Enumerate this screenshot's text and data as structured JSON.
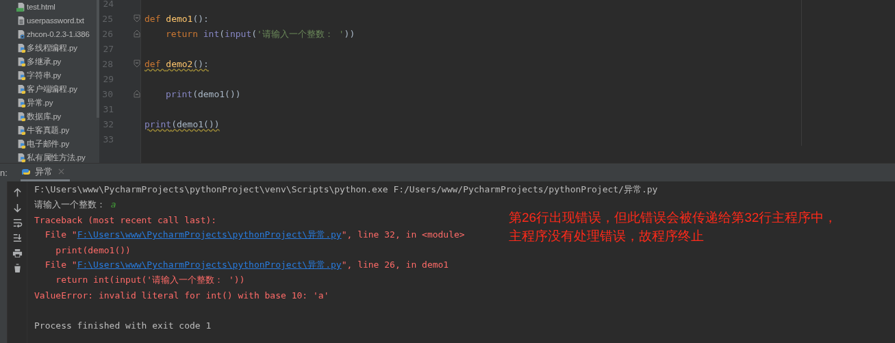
{
  "project_tree": {
    "items": [
      {
        "name": "test.html",
        "kind": "html"
      },
      {
        "name": "userpassword.txt",
        "kind": "text"
      },
      {
        "name": "zhcon-0.2.3-1.i386",
        "kind": "unknown"
      },
      {
        "name": "多线程编程.py",
        "kind": "python"
      },
      {
        "name": "多继承.py",
        "kind": "python"
      },
      {
        "name": "字符串.py",
        "kind": "python"
      },
      {
        "name": "客户端编程.py",
        "kind": "python"
      },
      {
        "name": "异常.py",
        "kind": "python"
      },
      {
        "name": "数据库.py",
        "kind": "python"
      },
      {
        "name": "牛客真题.py",
        "kind": "python"
      },
      {
        "name": "电子邮件.py",
        "kind": "python"
      },
      {
        "name": "私有属性方法.py",
        "kind": "python"
      }
    ]
  },
  "editor": {
    "lines": [
      {
        "number": "24"
      },
      {
        "number": "25",
        "fold_start": true,
        "fold_end": false,
        "indented": false,
        "warning": false,
        "tokens": [
          {
            "kind": "keyword",
            "text": "def "
          },
          {
            "kind": "defname",
            "text": "demo1"
          },
          {
            "kind": "plain",
            "text": "():"
          }
        ]
      },
      {
        "number": "26",
        "fold_start": false,
        "fold_end": true,
        "indented": true,
        "warning": false,
        "tokens": [
          {
            "kind": "keyword",
            "text": "return "
          },
          {
            "kind": "builtin",
            "text": "int"
          },
          {
            "kind": "plain",
            "text": "("
          },
          {
            "kind": "builtin",
            "text": "input"
          },
          {
            "kind": "plain",
            "text": "("
          },
          {
            "kind": "string",
            "text": "'请输入一个整数： '"
          },
          {
            "kind": "plain",
            "text": "))"
          }
        ]
      },
      {
        "number": "27"
      },
      {
        "number": "28",
        "fold_start": true,
        "fold_end": false,
        "indented": false,
        "warning": true,
        "tokens": [
          {
            "kind": "keyword",
            "text": "def "
          },
          {
            "kind": "defname",
            "text": "demo2"
          },
          {
            "kind": "plain",
            "text": "():"
          }
        ]
      },
      {
        "number": "29"
      },
      {
        "number": "30",
        "fold_start": false,
        "fold_end": true,
        "indented": true,
        "warning": false,
        "tokens": [
          {
            "kind": "builtin",
            "text": "print"
          },
          {
            "kind": "plain",
            "text": "(demo1())"
          }
        ]
      },
      {
        "number": "31"
      },
      {
        "number": "32",
        "fold_start": false,
        "fold_end": false,
        "indented": false,
        "warning": true,
        "tokens": [
          {
            "kind": "builtin",
            "text": "print"
          },
          {
            "kind": "plain",
            "text": "(demo1())"
          }
        ]
      },
      {
        "number": "33"
      }
    ]
  },
  "run_panel": {
    "label": "n:",
    "tab": {
      "title": "异常",
      "selected": true
    },
    "console": [
      {
        "kind": "command",
        "segments": [
          {
            "kind": "text",
            "text": "F:\\Users\\www\\PycharmProjects\\pythonProject\\venv\\Scripts\\python.exe F:/Users/www/PycharmProjects/pythonProject/异常.py"
          }
        ]
      },
      {
        "kind": "prompt",
        "segments": [
          {
            "kind": "text",
            "text": "请输入一个整数： "
          },
          {
            "kind": "input",
            "text": "a"
          }
        ]
      },
      {
        "kind": "error",
        "segments": [
          {
            "kind": "text",
            "text": "Traceback (most recent call last):"
          }
        ]
      },
      {
        "kind": "error",
        "segments": [
          {
            "kind": "text",
            "text": "  File \""
          },
          {
            "kind": "link",
            "text": "F:\\Users\\www\\PycharmProjects\\pythonProject\\异常.py"
          },
          {
            "kind": "text",
            "text": "\", line 32, in <module>"
          }
        ]
      },
      {
        "kind": "error",
        "segments": [
          {
            "kind": "text",
            "text": "    print(demo1())"
          }
        ]
      },
      {
        "kind": "error",
        "segments": [
          {
            "kind": "text",
            "text": "  File \""
          },
          {
            "kind": "link",
            "text": "F:\\Users\\www\\PycharmProjects\\pythonProject\\异常.py"
          },
          {
            "kind": "text",
            "text": "\", line 26, in demo1"
          }
        ]
      },
      {
        "kind": "error",
        "segments": [
          {
            "kind": "text",
            "text": "    return int(input('请输入一个整数： '))"
          }
        ]
      },
      {
        "kind": "error",
        "segments": [
          {
            "kind": "text",
            "text": "ValueError: invalid literal for int() with base 10: 'a'"
          }
        ]
      },
      {
        "kind": "blank"
      },
      {
        "kind": "command",
        "segments": [
          {
            "kind": "text",
            "text": "Process finished with exit code 1"
          }
        ]
      }
    ],
    "note": [
      "第26行出现错误，但此错误会被传递给第32行主程序中，",
      "主程序没有处理错误，故程序终止"
    ]
  }
}
